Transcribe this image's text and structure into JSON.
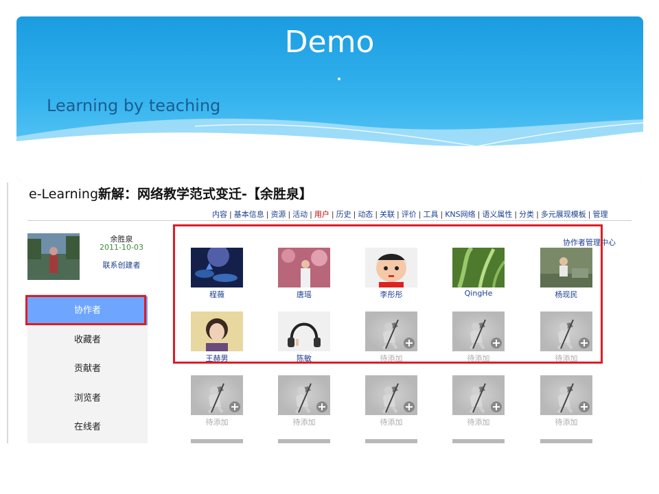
{
  "slide": {
    "title": "Demo",
    "subtitle": "Learning by teaching"
  },
  "page": {
    "heading_en": "e-Learning",
    "heading_cn": "新解：网络教学范式变迁-【余胜泉】",
    "nav": [
      "内容",
      "基本信息",
      "资源",
      "活动",
      "用户",
      "历史",
      "动态",
      "关联",
      "评价",
      "工具",
      "KNS网络",
      "语义属性",
      "分类",
      "多元展现模板",
      "管理"
    ],
    "nav_active_index": 4
  },
  "creator": {
    "name": "余胜泉",
    "date": "2011-10-03",
    "contact": "联系创建者"
  },
  "sidebar": {
    "items": [
      {
        "label": "协作者",
        "active": true
      },
      {
        "label": "收藏者",
        "active": false
      },
      {
        "label": "贡献者",
        "active": false
      },
      {
        "label": "浏览者",
        "active": false
      },
      {
        "label": "在线者",
        "active": false
      }
    ]
  },
  "collaborators": {
    "manage_link": "协作者管理中心",
    "rows": [
      [
        {
          "name": "程薇",
          "thumb": "lotus-photo"
        },
        {
          "name": "唐瑶",
          "thumb": "blossom-portrait"
        },
        {
          "name": "李彤彤",
          "thumb": "cartoon-avatar"
        },
        {
          "name": "QingHe",
          "thumb": "leaves-photo"
        },
        {
          "name": "杨现民",
          "thumb": "child-photo"
        }
      ],
      [
        {
          "name": "王赫男",
          "thumb": "portrait"
        },
        {
          "name": "陈敏",
          "thumb": "headphones"
        },
        {
          "name": "待添加",
          "thumb": "placeholder"
        },
        {
          "name": "待添加",
          "thumb": "placeholder"
        },
        {
          "name": "待添加",
          "thumb": "placeholder"
        }
      ],
      [
        {
          "name": "待添加",
          "thumb": "placeholder"
        },
        {
          "name": "待添加",
          "thumb": "placeholder"
        },
        {
          "name": "待添加",
          "thumb": "placeholder"
        },
        {
          "name": "待添加",
          "thumb": "placeholder"
        },
        {
          "name": "待添加",
          "thumb": "placeholder"
        }
      ]
    ]
  },
  "colors": {
    "highlight": "#e01b23",
    "active_tab": "#6ea6ff",
    "link": "#1b3f8f",
    "banner": "#1a9ce0"
  }
}
